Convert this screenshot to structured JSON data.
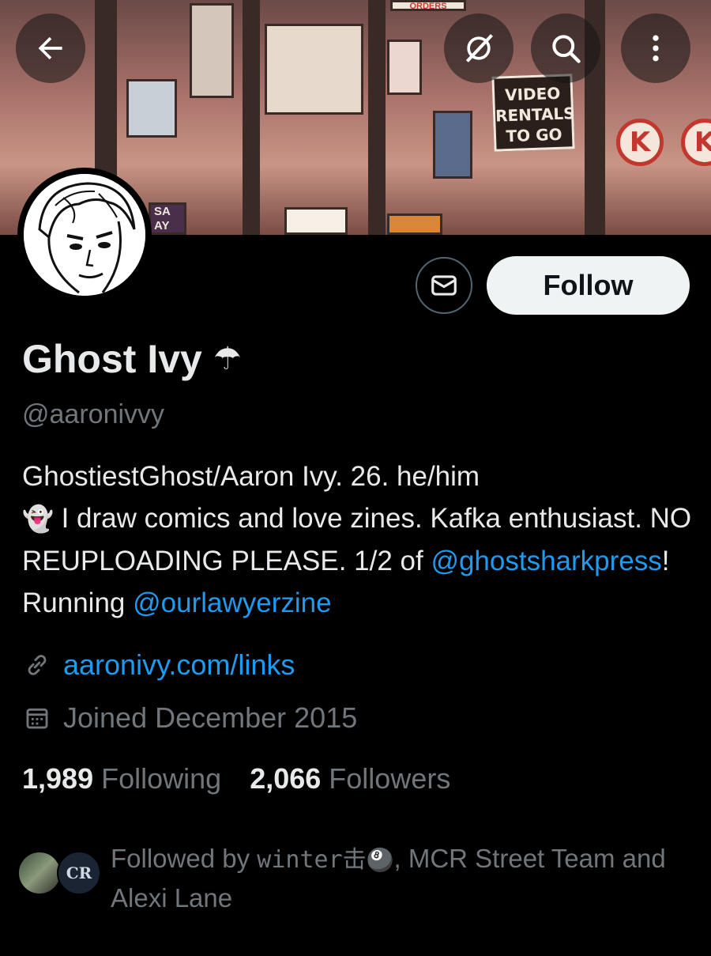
{
  "banner": {
    "sign_lines": [
      "VIDEO",
      "RENTALS",
      "TO GO"
    ],
    "poster_text": [
      "ORDERS",
      "SA",
      "AY"
    ],
    "k_letter": "K"
  },
  "nav": {
    "back_icon": "arrow-left-icon",
    "grok_icon": "grok-icon",
    "search_icon": "search-icon",
    "more_icon": "more-vertical-icon"
  },
  "profile": {
    "name": "Ghost Ivy",
    "name_emoji": "☂",
    "handle": "@aaronivvy",
    "bio": {
      "line1": "GhostiestGhost/Aaron Ivy. 26. he/him",
      "emoji": "👻",
      "text2": " I draw comics and love zines. Kafka enthusiast. NO REUPLOADING PLEASE. 1/2 of ",
      "mention1": "@ghostsharkpress",
      "text3": "! Running ",
      "mention2": "@ourlawyerzine"
    },
    "website": "aaronivy.com/links",
    "joined": "Joined December 2015",
    "following_count": "1,989",
    "following_label": "Following",
    "followers_count": "2,066",
    "followers_label": "Followers"
  },
  "actions": {
    "message_icon": "envelope-icon",
    "follow_label": "Follow"
  },
  "followed_by": {
    "prefix": "Followed by ",
    "user1": "winter击",
    "user1_emoji": "🎱",
    "rest": ", MCR Street Team and Alexi Lane",
    "avatar2_text": "CR"
  },
  "colors": {
    "accent": "#1d9bf0",
    "muted": "#71767b",
    "text": "#e7e9ea",
    "background": "#000000"
  }
}
